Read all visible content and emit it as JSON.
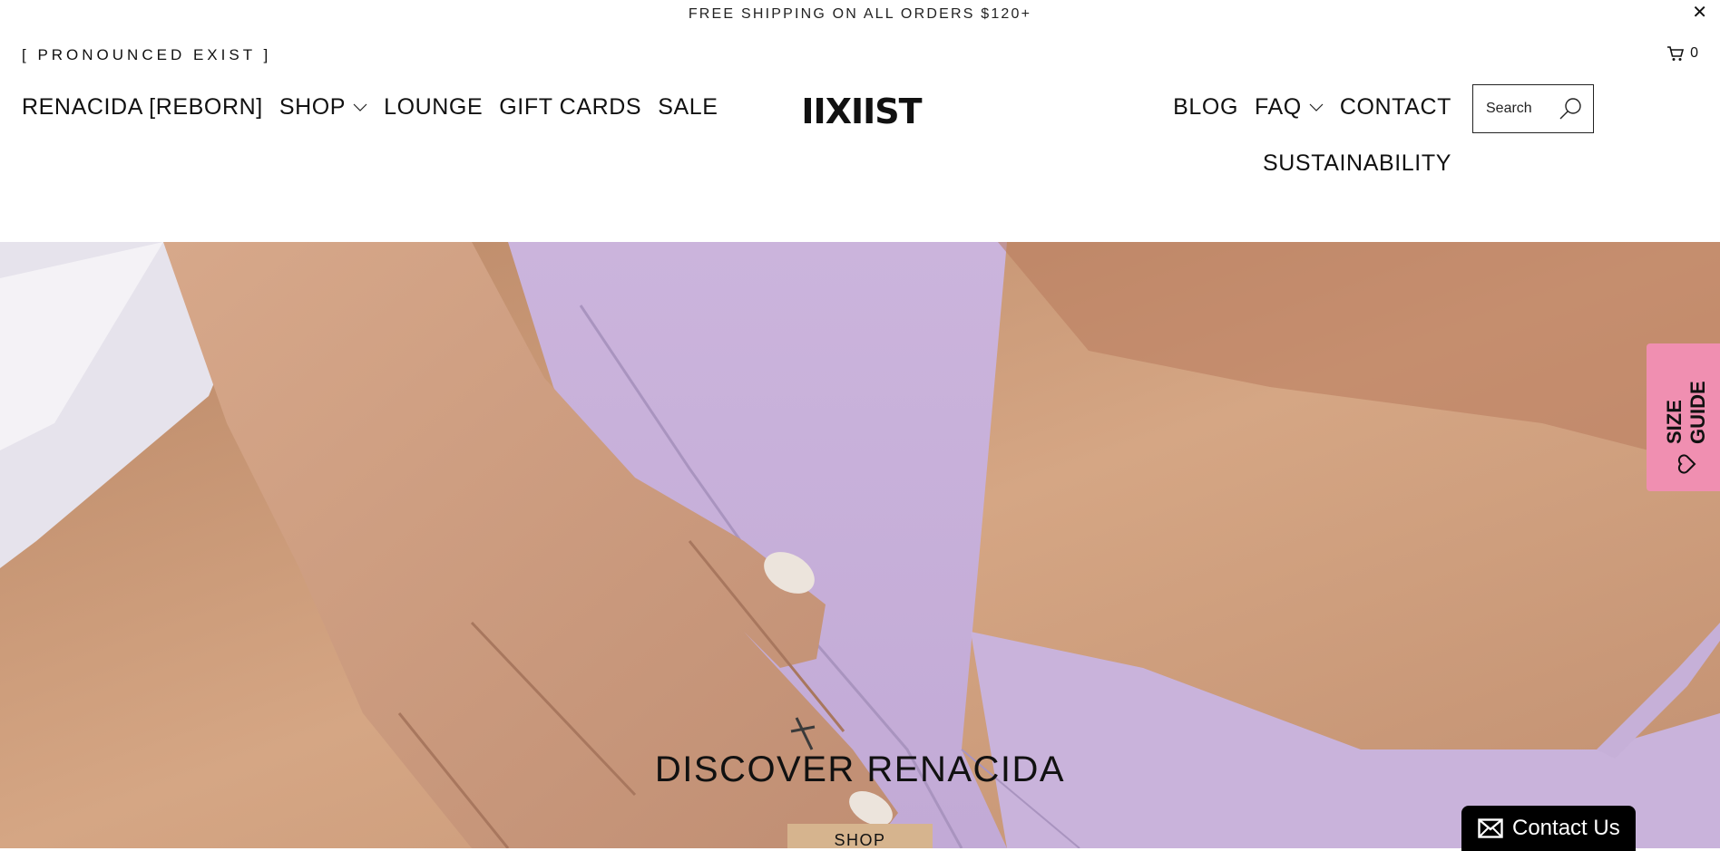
{
  "announcement": {
    "text": "FREE SHIPPING ON ALL ORDERS $120+",
    "close_label": "✕"
  },
  "header": {
    "tagline": "[ PRONOUNCED EXIST ]",
    "cart_count": "0",
    "logo_text": "IIXIIST",
    "nav_left": [
      {
        "label": "RENACIDA [REBORN]"
      },
      {
        "label": "SHOP",
        "has_dropdown": true
      },
      {
        "label": "LOUNGE"
      },
      {
        "label": "GIFT CARDS"
      },
      {
        "label": "SALE"
      }
    ],
    "nav_right": [
      {
        "label": "BLOG"
      },
      {
        "label": "FAQ",
        "has_dropdown": true
      },
      {
        "label": "CONTACT"
      }
    ],
    "nav_right_row2": {
      "label": "SUSTAINABILITY"
    },
    "search": {
      "placeholder": "Search",
      "value": ""
    }
  },
  "hero": {
    "title": "DISCOVER RENACIDA",
    "button_label": "SHOP"
  },
  "size_guide": {
    "line1": "SIZE",
    "line2": "GUIDE",
    "icon": "heart-icon"
  },
  "contact_widget": {
    "label": "Contact Us",
    "icon": "envelope-icon"
  },
  "colors": {
    "size_guide_bg": "#f08fb1",
    "hero_button_bg": "#d6b48e",
    "contact_bg": "#000000",
    "garment_lilac": "#c7b1da"
  }
}
